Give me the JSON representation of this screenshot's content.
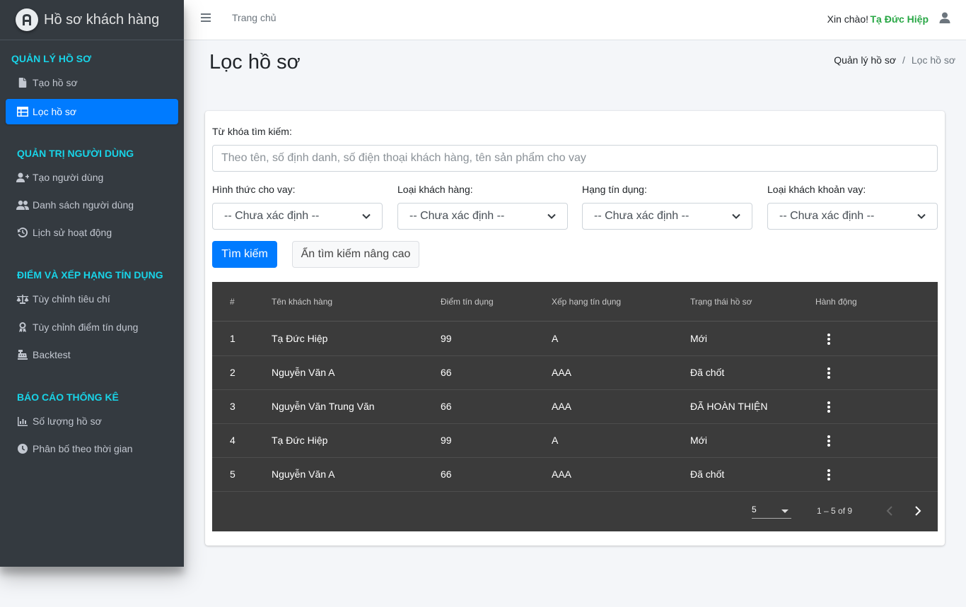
{
  "brand": {
    "title": "Hồ sơ khách hàng"
  },
  "sidebar": {
    "sections": [
      {
        "header": "QUẢN LÝ HỒ SƠ",
        "items": [
          {
            "label": "Tạo hồ sơ",
            "icon": "file-icon"
          },
          {
            "label": "Lọc hồ sơ",
            "icon": "table-icon",
            "active": true
          }
        ]
      },
      {
        "header": "QUẢN TRỊ NGƯỜI DÙNG",
        "items": [
          {
            "label": "Tạo người dùng",
            "icon": "user-plus-icon"
          },
          {
            "label": "Danh sách người dùng",
            "icon": "users-icon"
          },
          {
            "label": "Lịch sử hoạt động",
            "icon": "history-icon"
          }
        ]
      },
      {
        "header": "ĐIỂM VÀ XẾP HẠNG TÍN DỤNG",
        "items": [
          {
            "label": "Tùy chỉnh tiêu chí",
            "icon": "balance-scale-icon"
          },
          {
            "label": "Tùy chỉnh điểm tín dụng",
            "icon": "award-icon"
          },
          {
            "label": "Backtest",
            "icon": "cash-register-icon"
          }
        ]
      },
      {
        "header": "BÁO CÁO THỐNG KÊ",
        "items": [
          {
            "label": "Số lượng hồ sơ",
            "icon": "bar-chart-icon"
          },
          {
            "label": "Phân bố theo thời gian",
            "icon": "clock-icon"
          }
        ]
      }
    ]
  },
  "topbar": {
    "home_link": "Trang chủ",
    "greeting": "Xin chào!",
    "username": "Tạ Đức Hiệp"
  },
  "page": {
    "title": "Lọc hồ sơ",
    "breadcrumb": {
      "parent": "Quản lý hồ sơ",
      "separator": "/",
      "current": "Lọc hồ sơ"
    }
  },
  "filter": {
    "keyword_label": "Từ khóa tìm kiếm:",
    "keyword_placeholder": "Theo tên, số định danh, số điện thoại khách hàng, tên sản phẩm cho vay",
    "keyword_value": "",
    "selects": [
      {
        "label": "Hình thức cho vay:",
        "value": "-- Chưa xác định --"
      },
      {
        "label": "Loại khách hàng:",
        "value": "-- Chưa xác định --"
      },
      {
        "label": "Hạng tín dụng:",
        "value": "-- Chưa xác định --"
      },
      {
        "label": "Loại khách khoản vay:",
        "value": "-- Chưa xác định --"
      }
    ],
    "search_button": "Tìm kiếm",
    "toggle_advanced_button": "Ẩn tìm kiếm nâng cao"
  },
  "table": {
    "columns": [
      "#",
      "Tên khách hàng",
      "Điểm tín dụng",
      "Xếp hạng tín dụng",
      "Trạng thái hồ sơ",
      "Hành động"
    ],
    "rows": [
      [
        "1",
        "Tạ Đức Hiệp",
        "99",
        "A",
        "Mới"
      ],
      [
        "2",
        "Nguyễn Văn A",
        "66",
        "AAA",
        "Đã chốt"
      ],
      [
        "3",
        "Nguyễn Văn Trung Văn",
        "66",
        "AAA",
        "ĐÃ HOÀN THIỆN"
      ],
      [
        "4",
        "Tạ Đức Hiệp",
        "99",
        "A",
        "Mới"
      ],
      [
        "5",
        "Nguyễn Văn A",
        "66",
        "AAA",
        "Đã chốt"
      ]
    ],
    "paginator": {
      "page_size": "5",
      "range": "1 – 5 of 9"
    }
  },
  "colors": {
    "sidebar_bg": "#343a40",
    "sidebar_header": "#18d4e8",
    "active_item": "#007bff",
    "username": "#28a745",
    "table_bg": "#3b3b3b"
  }
}
